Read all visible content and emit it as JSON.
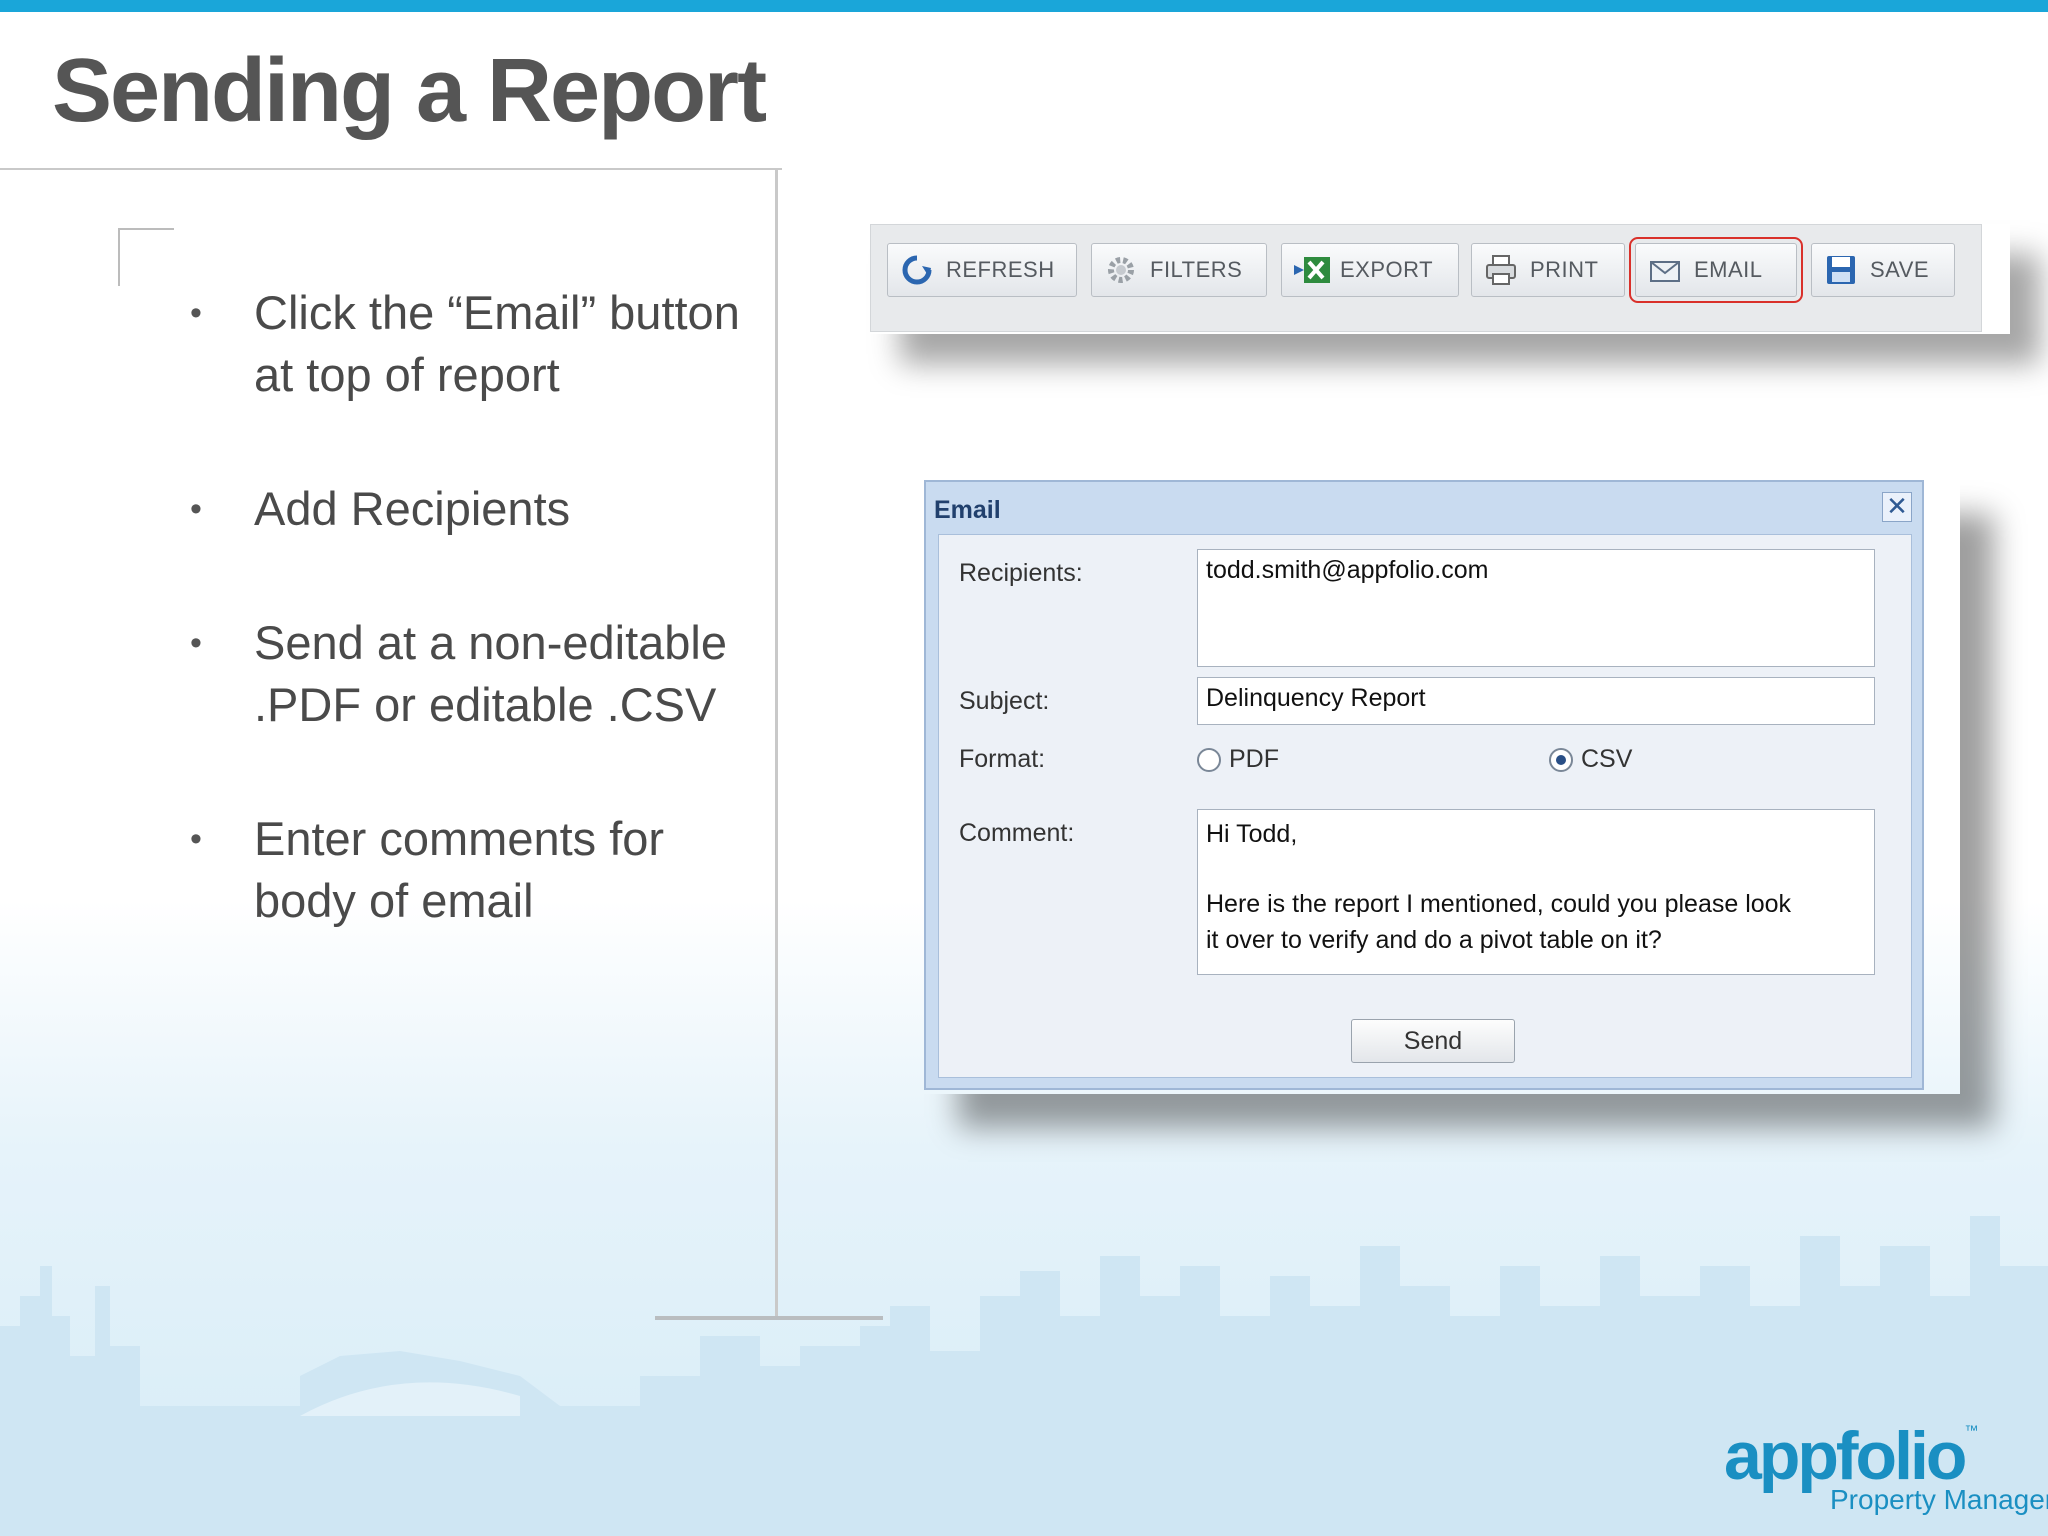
{
  "slide": {
    "title": "Sending a Report",
    "bullets": [
      "Click the “Email” button at top of report",
      "Add Recipients",
      "Send at a non-editable .PDF or editable .CSV",
      "Enter comments for body of email"
    ],
    "bullet_glyph": "•"
  },
  "toolbar": {
    "buttons": [
      {
        "label": "REFRESH",
        "icon": "refresh-icon"
      },
      {
        "label": "FILTERS",
        "icon": "gear-icon"
      },
      {
        "label": "EXPORT",
        "icon": "excel-export-icon"
      },
      {
        "label": "PRINT",
        "icon": "printer-icon"
      },
      {
        "label": "EMAIL",
        "icon": "envelope-icon",
        "highlighted": true
      },
      {
        "label": "SAVE",
        "icon": "floppy-disk-icon"
      }
    ],
    "highlight_color": "#d9302a"
  },
  "email_dialog": {
    "title": "Email",
    "close_glyph": "✕",
    "recipients_label": "Recipients:",
    "recipients_value": "todd.smith@appfolio.com",
    "subject_label": "Subject:",
    "subject_value": "Delinquency Report",
    "format_label": "Format:",
    "format_options": [
      {
        "label": "PDF",
        "selected": false
      },
      {
        "label": "CSV",
        "selected": true
      }
    ],
    "comment_label": "Comment:",
    "comment_line1": "Hi Todd,",
    "comment_line2": "Here is the report I mentioned, could you please look",
    "comment_line3": "it over to verify and do a pivot table on it?",
    "send_label": "Send"
  },
  "branding": {
    "logo_text": "appfolio",
    "logo_tm": "™",
    "logo_subtext": "Property Manager",
    "accent_color": "#1aa6d9"
  }
}
